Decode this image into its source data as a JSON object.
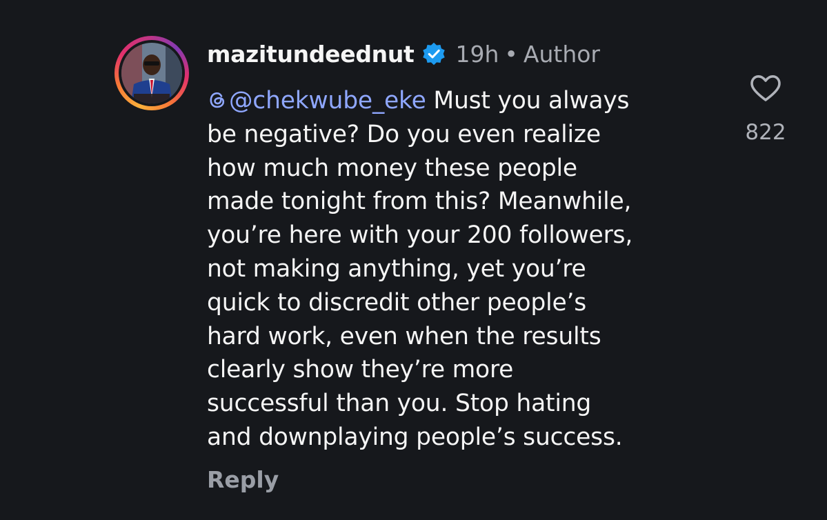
{
  "comment": {
    "username": "mazitundeednut",
    "verified": true,
    "time": "19h",
    "separator": "•",
    "role": "Author",
    "mention": "@chekwube_eke",
    "lines": [
      " Must you always",
      "be negative? Do you even realize",
      "how much money these people",
      "made tonight from this? Meanwhile,",
      "you’re here with your 200 followers,",
      "not making anything, yet you’re",
      "quick to discredit other people’s",
      "hard work, even when the results",
      "clearly show they’re more",
      "successful than you. Stop hating",
      "and downplaying people’s success."
    ],
    "reply_label": "Reply",
    "like_count": "822"
  },
  "icons": {
    "verified": "verified-badge-icon",
    "mention": "threads-icon",
    "like": "heart-icon"
  },
  "colors": {
    "background": "#16181c",
    "text": "#f5f5f5",
    "muted": "#a8abb2",
    "mention": "#8fa7ff",
    "verified": "#1d9bf0"
  }
}
